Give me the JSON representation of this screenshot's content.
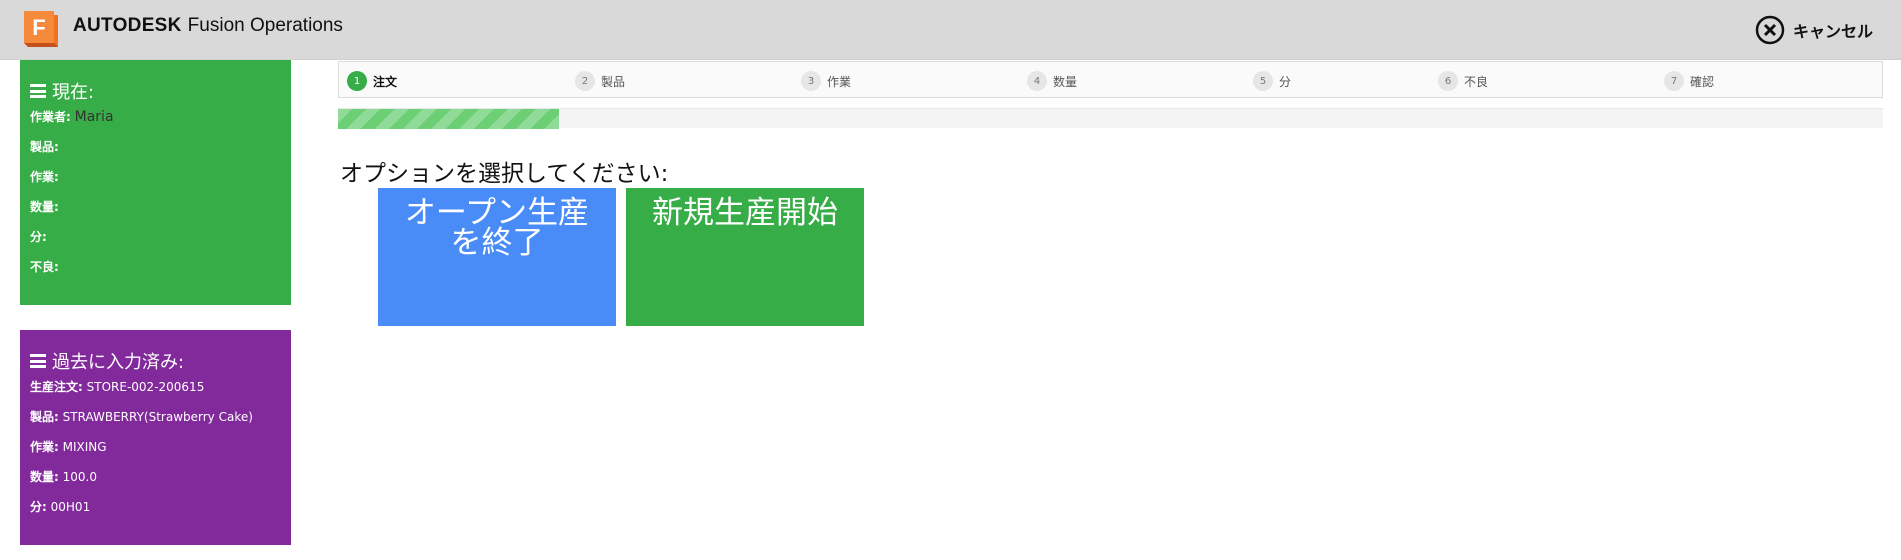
{
  "header": {
    "logo_letter": "F",
    "brand_bold": "AUTODESK",
    "brand_product": "Fusion Operations",
    "cancel_label": "キャンセル",
    "colors": {
      "background": "#d9d9d9",
      "logo": "#f37021"
    }
  },
  "current": {
    "title": "現在:",
    "rows": [
      {
        "key": "作業者:",
        "value": "Maria"
      },
      {
        "key": "製品:",
        "value": ""
      },
      {
        "key": "作業:",
        "value": ""
      },
      {
        "key": "数量:",
        "value": ""
      },
      {
        "key": "分:",
        "value": ""
      },
      {
        "key": "不良:",
        "value": ""
      }
    ],
    "color": "#37ad47"
  },
  "past": {
    "title": "過去に入力済み:",
    "rows": [
      {
        "key": "生産注文:",
        "value": "STORE-002-200615"
      },
      {
        "key": "製品:",
        "value": "STRAWBERRY(Strawberry Cake)"
      },
      {
        "key": "作業:",
        "value": "MIXING"
      },
      {
        "key": "数量:",
        "value": "100.0"
      },
      {
        "key": "分:",
        "value": "00H01"
      }
    ],
    "color": "#82299b"
  },
  "steps": [
    {
      "num": "1",
      "label": "注文",
      "active": true
    },
    {
      "num": "2",
      "label": "製品",
      "active": false
    },
    {
      "num": "3",
      "label": "作業",
      "active": false
    },
    {
      "num": "4",
      "label": "数量",
      "active": false
    },
    {
      "num": "5",
      "label": "分",
      "active": false
    },
    {
      "num": "6",
      "label": "不良",
      "active": false
    },
    {
      "num": "7",
      "label": "確認",
      "active": false
    }
  ],
  "progress": {
    "fraction": 0.143
  },
  "main": {
    "prompt": "オプションを選択してください:",
    "options": {
      "end_open_line1": "オープン生産",
      "end_open_line2": "を終了",
      "new_production": "新規生産開始"
    },
    "colors": {
      "end_open": "#4a8cf7",
      "new_production": "#37ad47"
    }
  }
}
